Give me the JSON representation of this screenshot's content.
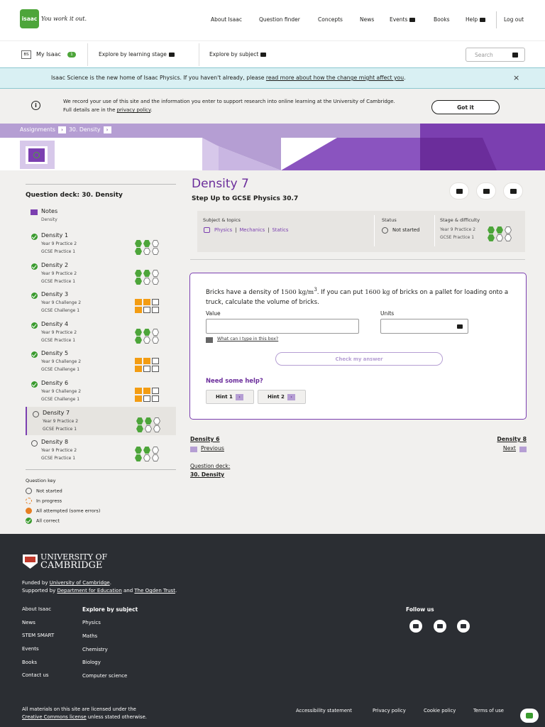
{
  "header": {
    "logo_text": "isaac",
    "tagline": "You work it out.",
    "nav": [
      {
        "label": "About Isaac"
      },
      {
        "label": "Question finder"
      },
      {
        "label": "Concepts"
      },
      {
        "label": "News"
      },
      {
        "label": "Events"
      },
      {
        "label": "Books"
      },
      {
        "label": "Help"
      },
      {
        "label": "Log out"
      }
    ]
  },
  "subnav": {
    "initials": "BS",
    "my_isaac": "My Isaac",
    "my_isaac_count": "1",
    "explore_stage": "Explore by learning stage",
    "explore_subject": "Explore by subject",
    "search_placeholder": "Search"
  },
  "banner": {
    "text": "Isaac Science is the new home of Isaac Physics. If you haven't already, please ",
    "link": "read more about how the change might affect you",
    "suffix": ".",
    "close": "×"
  },
  "cookie": {
    "text": "We record your use of this site and the information you enter to support research into online learning at the University of Cambridge. Full details are in the ",
    "link": "privacy policy",
    "suffix": ".",
    "button": "Got it"
  },
  "breadcrumb": {
    "root": "Assignments",
    "deck": "30. Density"
  },
  "sidebar": {
    "title": "Question deck: 30. Density",
    "notes": {
      "label": "Notes",
      "sub": "Density"
    },
    "questions": [
      {
        "title": "Density 1",
        "s1": "Year 9 Practice 2",
        "s2": "GCSE Practice 1",
        "status": "done",
        "kind": "practice",
        "l1": 2,
        "l2": 1
      },
      {
        "title": "Density 2",
        "s1": "Year 9 Practice 2",
        "s2": "GCSE Practice 1",
        "status": "done",
        "kind": "practice",
        "l1": 2,
        "l2": 1
      },
      {
        "title": "Density 3",
        "s1": "Year 9 Challenge 2",
        "s2": "GCSE Challenge 1",
        "status": "done",
        "kind": "challenge",
        "l1": 2,
        "l2": 1
      },
      {
        "title": "Density 4",
        "s1": "Year 9 Practice 2",
        "s2": "GCSE Practice 1",
        "status": "done",
        "kind": "practice",
        "l1": 2,
        "l2": 1
      },
      {
        "title": "Density 5",
        "s1": "Year 9 Challenge 2",
        "s2": "GCSE Challenge 1",
        "status": "done",
        "kind": "challenge",
        "l1": 2,
        "l2": 1
      },
      {
        "title": "Density 6",
        "s1": "Year 9 Challenge 2",
        "s2": "GCSE Challenge 1",
        "status": "done",
        "kind": "challenge",
        "l1": 2,
        "l2": 1
      },
      {
        "title": "Density 7",
        "s1": "Year 9 Practice 2",
        "s2": "GCSE Practice 1",
        "status": "none",
        "kind": "practice",
        "l1": 2,
        "l2": 1,
        "current": true
      },
      {
        "title": "Density 8",
        "s1": "Year 9 Practice 2",
        "s2": "GCSE Practice 1",
        "status": "none",
        "kind": "practice",
        "l1": 2,
        "l2": 1
      }
    ],
    "key_title": "Question key",
    "key": [
      {
        "label": "Not started"
      },
      {
        "label": "In progress"
      },
      {
        "label": "All attempted (some errors)"
      },
      {
        "label": "All correct"
      }
    ]
  },
  "question": {
    "title": "Density 7",
    "subtitle": "Step Up to GCSE Physics 30.7",
    "meta": {
      "subject_header": "Subject & topics",
      "topics": [
        "Physics",
        "Mechanics",
        "Statics"
      ],
      "status_header": "Status",
      "status": "Not started",
      "stage_header": "Stage & difficulty",
      "stage1": "Year 9 Practice 2",
      "stage2": "GCSE Practice 1"
    },
    "text_a": "Bricks have a density of ",
    "density_num": "1500",
    "density_unit": " kg/m",
    "density_exp": "3",
    "text_b": ". If you can put ",
    "mass_num": "1600",
    "mass_unit": " kg",
    "text_c": " of bricks on a pallet for loading onto a truck, calculate the volume of bricks.",
    "value_label": "Value",
    "units_label": "Units",
    "help_link": "What can I type in this box?",
    "check_button": "Check my answer",
    "need_help": "Need some help?",
    "hint1": "Hint 1",
    "hint2": "Hint 2"
  },
  "pager": {
    "prev_title": "Density 6",
    "prev_label": "Previous",
    "next_title": "Density 8",
    "next_label": "Next",
    "deck_label": "Question deck:",
    "deck_name": "30. Density"
  },
  "footer": {
    "uni_line1": "UNIVERSITY OF",
    "uni_line2": "CAMBRIDGE",
    "funded_prefix": "Funded by ",
    "funded_link": "University of Cambridge",
    "funded_suffix": ".",
    "supported_prefix": "Supported by ",
    "supported_link1": "Department for Education",
    "supported_and": " and ",
    "supported_link2": "The Ogden Trust",
    "supported_suffix": ".",
    "col1": [
      "About Isaac",
      "News",
      "STEM SMART",
      "Events",
      "Books",
      "Contact us"
    ],
    "col2_head": "Explore by subject",
    "col2": [
      "Physics",
      "Maths",
      "Chemistry",
      "Biology",
      "Computer science"
    ],
    "follow": "Follow us",
    "license_line1": "All materials on this site are licensed under the",
    "license_link": "Creative Commons license",
    "license_suffix": " unless stated otherwise.",
    "legal": [
      "Accessibility statement",
      "Privacy policy",
      "Cookie policy",
      "Terms of use"
    ]
  },
  "colors": {
    "brand_purple": "#7b3fb0",
    "light_purple": "#b59ed3",
    "green": "#4da53a",
    "orange": "#f39c12",
    "footer_bg": "#2b2e33"
  }
}
